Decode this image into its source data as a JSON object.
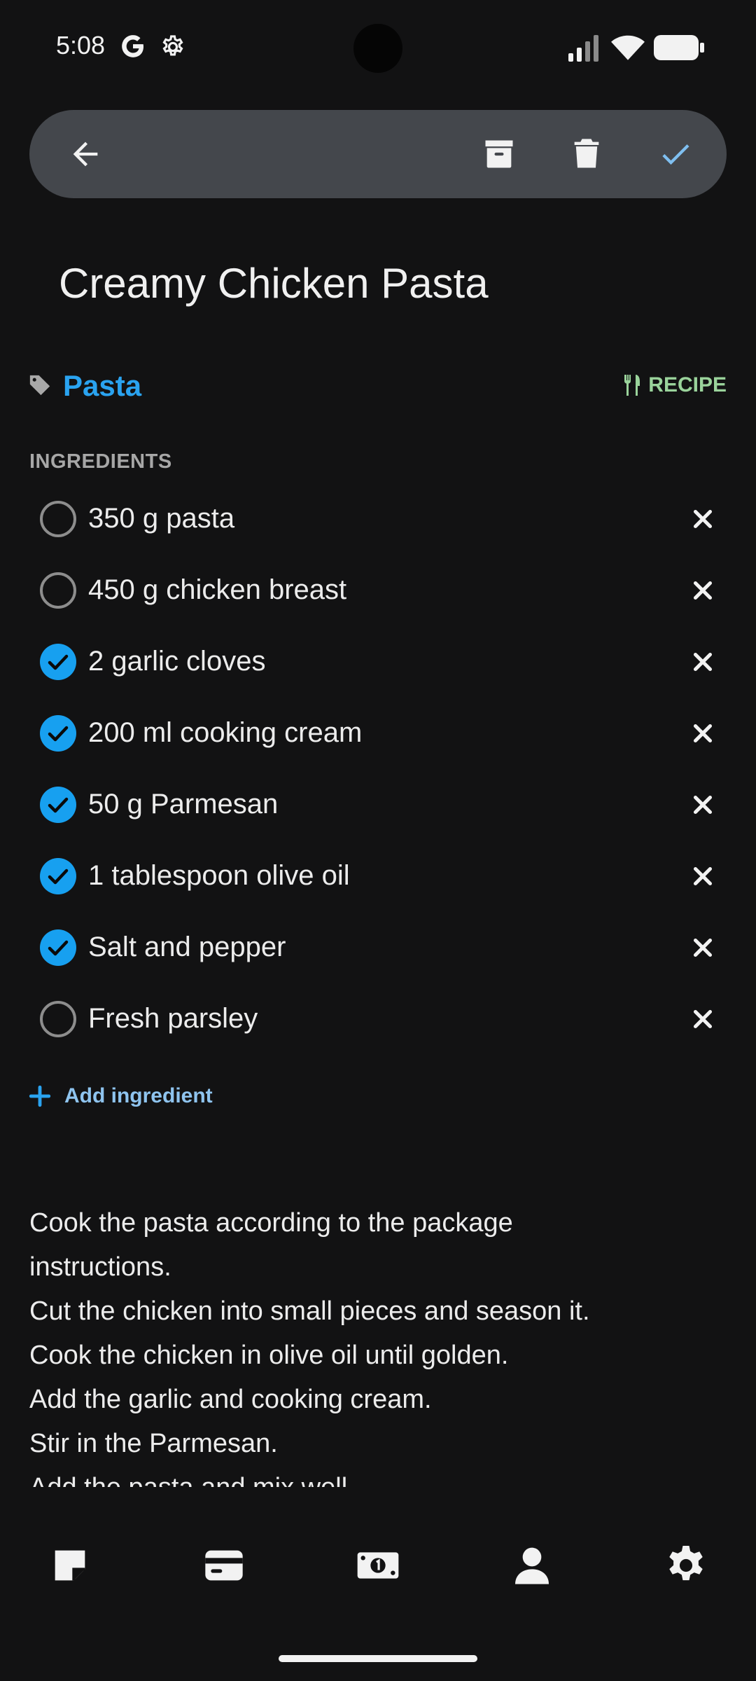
{
  "status_bar": {
    "time": "5:08"
  },
  "note": {
    "title": "Creamy Chicken Pasta",
    "tag": "Pasta",
    "type_label": "RECIPE"
  },
  "ingredients": {
    "section_label": "INGREDIENTS",
    "items": [
      {
        "text": "350 g pasta",
        "checked": false
      },
      {
        "text": "450 g chicken breast",
        "checked": false
      },
      {
        "text": "2 garlic cloves",
        "checked": true
      },
      {
        "text": "200 ml cooking cream",
        "checked": true
      },
      {
        "text": "50 g Parmesan",
        "checked": true
      },
      {
        "text": "1 tablespoon olive oil",
        "checked": true
      },
      {
        "text": "Salt and pepper",
        "checked": true
      },
      {
        "text": "Fresh parsley",
        "checked": false
      }
    ],
    "add_label": "Add ingredient"
  },
  "instructions": {
    "lines": [
      "Cook the pasta according to the package",
      "instructions.",
      "Cut the chicken into small pieces and season it.",
      "Cook the chicken in olive oil until golden.",
      "Add the garlic and cooking cream.",
      "Stir in the Parmesan.",
      "Add the pasta and mix well."
    ]
  },
  "colors": {
    "accent": "#2aa3f0",
    "recipe_badge": "#9ad39b",
    "toolbar_bg": "#44474c",
    "background": "#121213"
  }
}
